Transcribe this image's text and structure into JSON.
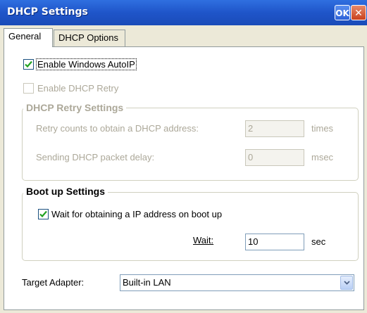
{
  "window": {
    "title": "DHCP Settings",
    "ok_label": "OK",
    "close_label": "✕"
  },
  "tabs": [
    {
      "label": "General",
      "selected": true
    },
    {
      "label": "DHCP Options",
      "selected": false
    }
  ],
  "general": {
    "enable_autoip": {
      "label": "Enable Windows AutoIP",
      "checked": true,
      "enabled": true
    },
    "enable_dhcp_retry": {
      "label": "Enable DHCP Retry",
      "checked": false,
      "enabled": false
    }
  },
  "retry_settings": {
    "title": "DHCP Retry Settings",
    "retry_counts": {
      "label": "Retry counts to obtain a DHCP address:",
      "value": "2",
      "unit": "times",
      "enabled": false
    },
    "packet_delay": {
      "label": "Sending DHCP packet delay:",
      "value": "0",
      "unit": "msec",
      "enabled": false
    }
  },
  "boot_settings": {
    "title": "Boot up Settings",
    "wait_obtain": {
      "label": "Wait for obtaining a IP address on boot up",
      "checked": true
    },
    "wait": {
      "label": "Wait:",
      "value": "10",
      "unit": "sec"
    }
  },
  "target_adapter": {
    "label": "Target Adapter:",
    "value": "Built-in LAN"
  },
  "colors": {
    "titlebar": "#1f55c9",
    "dialog_bg": "#ece9d8",
    "check_green": "#21a121"
  }
}
